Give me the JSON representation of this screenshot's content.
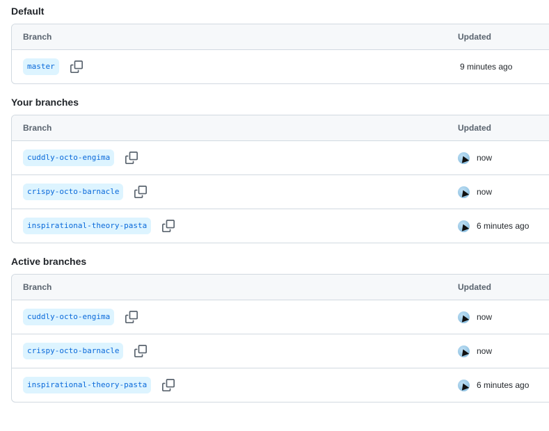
{
  "sections": [
    {
      "title": "Default",
      "col_branch": "Branch",
      "col_updated": "Updated",
      "rows": [
        {
          "branch": "master",
          "updated": "9 minutes ago",
          "avatar": false
        }
      ]
    },
    {
      "title": "Your branches",
      "col_branch": "Branch",
      "col_updated": "Updated",
      "rows": [
        {
          "branch": "cuddly-octo-engima",
          "updated": "now",
          "avatar": true
        },
        {
          "branch": "crispy-octo-barnacle",
          "updated": "now",
          "avatar": true
        },
        {
          "branch": "inspirational-theory-pasta",
          "updated": "6 minutes ago",
          "avatar": true
        }
      ]
    },
    {
      "title": "Active branches",
      "col_branch": "Branch",
      "col_updated": "Updated",
      "rows": [
        {
          "branch": "cuddly-octo-engima",
          "updated": "now",
          "avatar": true
        },
        {
          "branch": "crispy-octo-barnacle",
          "updated": "now",
          "avatar": true
        },
        {
          "branch": "inspirational-theory-pasta",
          "updated": "6 minutes ago",
          "avatar": true
        }
      ]
    }
  ],
  "icons": {
    "copy": "copy-icon",
    "avatar": "user-avatar"
  },
  "colors": {
    "branch_bg": "#ddf4ff",
    "branch_text": "#0969da",
    "header_bg": "#f6f8fa",
    "border": "#d1d9e0"
  }
}
